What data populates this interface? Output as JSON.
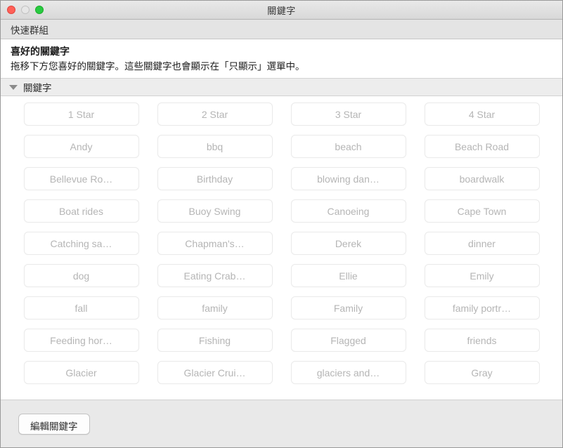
{
  "window": {
    "title": "關鍵字",
    "traffic_lights": {
      "close_label": "close",
      "minimize_label": "minimize",
      "maximize_label": "maximize",
      "close_color": "#ff6057",
      "minimize_color": "#e6e6e6",
      "maximize_color": "#28ca41"
    }
  },
  "toolbar": {
    "tab_label": "快速群組"
  },
  "intro": {
    "title": "喜好的關鍵字",
    "description": "拖移下方您喜好的關鍵字。這些關鍵字也會顯示在「只顯示」選單中。"
  },
  "section": {
    "disclosure_icon": "triangle-down-icon",
    "title": "關鍵字",
    "expanded": true
  },
  "keywords": [
    "1 Star",
    "2 Star",
    "3 Star",
    "4 Star",
    "Andy",
    "bbq",
    "beach",
    "Beach Road",
    "Bellevue Ro…",
    "Birthday",
    "blowing dan…",
    "boardwalk",
    "Boat rides",
    "Buoy Swing",
    "Canoeing",
    "Cape Town",
    "Catching sa…",
    "Chapman's…",
    "Derek",
    "dinner",
    "dog",
    "Eating Crab…",
    "Ellie",
    "Emily",
    "fall",
    "family",
    "Family",
    "family portr…",
    "Feeding hor…",
    "Fishing",
    "Flagged",
    "friends",
    "Glacier",
    "Glacier Crui…",
    "glaciers and…",
    "Gray"
  ],
  "footer": {
    "edit_button_label": "編輯關鍵字"
  },
  "colors": {
    "titlebar_top": "#e9e9e9",
    "titlebar_bottom": "#d8d8d8",
    "toolbar_bg": "#e4e4e4",
    "section_header_bg": "#ededed",
    "footer_bg": "#e9e9e9",
    "tag_text": "#b5b5b5",
    "tag_border": "#eaeaea"
  }
}
